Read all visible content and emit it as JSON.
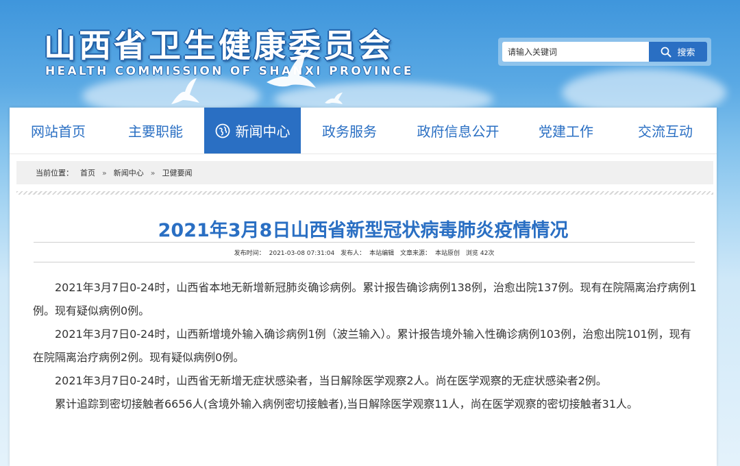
{
  "header": {
    "title": "山西省卫生健康委员会",
    "subtitle": "HEALTH COMMISSION OF SHANXI PROVINCE",
    "search": {
      "placeholder": "请输入关键词",
      "button_label": "搜索"
    }
  },
  "nav": {
    "items": [
      {
        "label": "网站首页",
        "active": false
      },
      {
        "label": "主要职能",
        "active": false
      },
      {
        "label": "新闻中心",
        "active": true,
        "icon": "globe-icon"
      },
      {
        "label": "政务服务",
        "active": false
      },
      {
        "label": "政府信息公开",
        "active": false
      },
      {
        "label": "党建工作",
        "active": false
      },
      {
        "label": "交流互动",
        "active": false
      }
    ]
  },
  "breadcrumb": {
    "prefix": "当前位置：",
    "items": [
      "首页",
      "新闻中心",
      "卫健要闻"
    ],
    "separator": "»"
  },
  "article": {
    "title": "2021年3月8日山西省新型冠状病毒肺炎疫情情况",
    "meta": {
      "publish_label": "发布时间：",
      "publish_time": "2021-03-08 07:31:04",
      "publisher_label": "发布人：",
      "publisher": "本站编辑",
      "source_label": "文章来源：",
      "source": "本站原创",
      "views_label": "浏览",
      "views": "42",
      "views_suffix": "次"
    },
    "paragraphs": [
      "2021年3月7日0-24时，山西省本地无新增新冠肺炎确诊病例。累计报告确诊病例138例，治愈出院137例。现有在院隔离治疗病例1例。现有疑似病例0例。",
      "2021年3月7日0-24时，山西新增境外输入确诊病例1例（波兰输入）。累计报告境外输入性确诊病例103例，治愈出院101例，现有在院隔离治疗病例2例。现有疑似病例0例。",
      "2021年3月7日0-24时，山西省无新增无症状感染者，当日解除医学观察2人。尚在医学观察的无症状感染者2例。",
      "累计追踪到密切接触者6656人(含境外输入病例密切接触者),当日解除医学观察11人，尚在医学观察的密切接触者31人。"
    ]
  },
  "colors": {
    "brand_blue": "#2a6fc3",
    "nav_active_bg": "#2a6fc3"
  }
}
